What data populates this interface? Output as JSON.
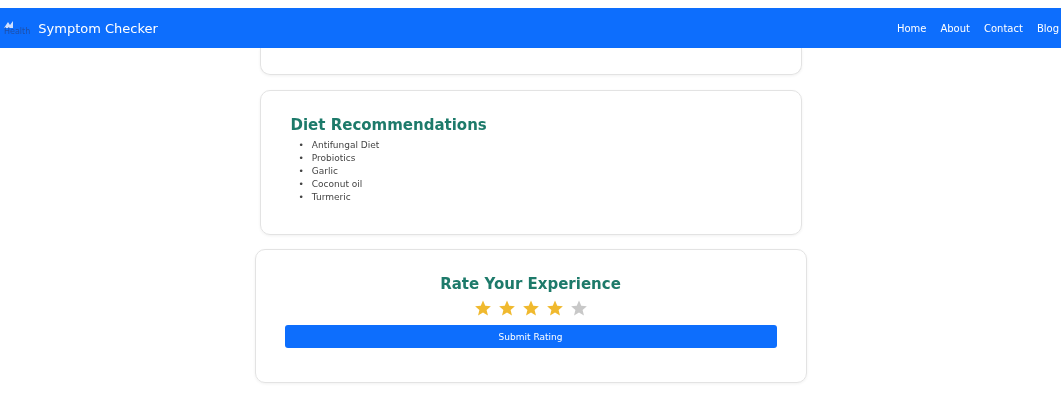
{
  "navbar": {
    "logo_alt": "Health",
    "title": "Symptom Checker",
    "links": [
      "Home",
      "About",
      "Contact",
      "Blog"
    ]
  },
  "diet": {
    "title": "Diet Recommendations",
    "bullet": "•",
    "items": [
      "Antifungal Diet",
      "Probiotics",
      "Garlic",
      "Coconut oil",
      "Turmeric"
    ]
  },
  "rating": {
    "title": "Rate Your Experience",
    "stars": 4,
    "button": "Submit Rating"
  }
}
